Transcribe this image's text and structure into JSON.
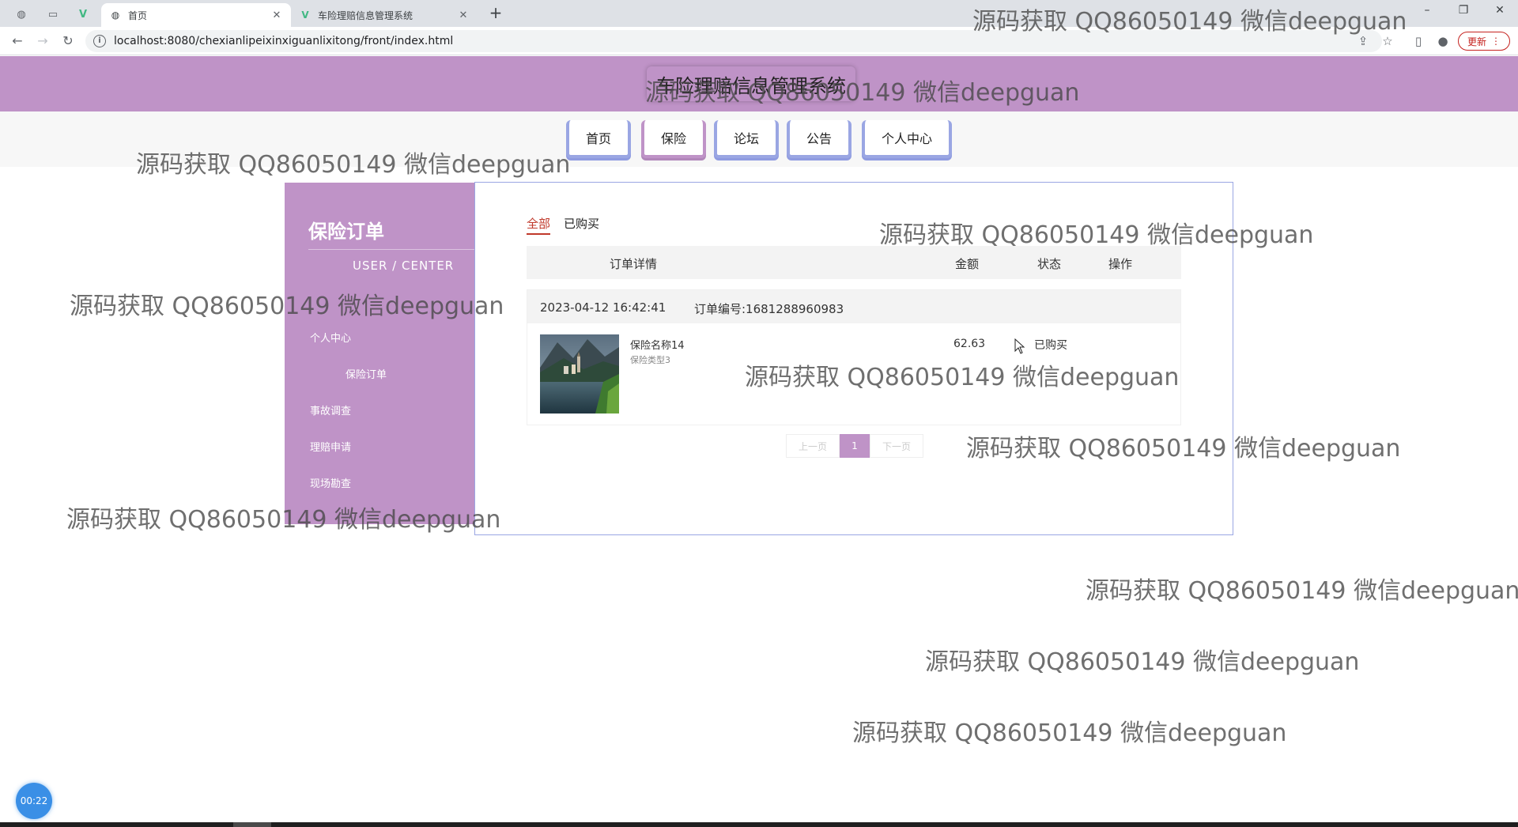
{
  "browser": {
    "tabs": [
      {
        "title": "首页",
        "active": true
      },
      {
        "title": "车险理赔信息管理系统",
        "active": false
      }
    ],
    "url": "localhost:8080/chexianlipeixinxiguanlixitong/front/index.html",
    "update_label": "更新"
  },
  "site": {
    "title": "车险理赔信息管理系统",
    "nav": [
      "首页",
      "保险",
      "论坛",
      "公告",
      "个人中心"
    ],
    "active_nav": "保险"
  },
  "sidebar": {
    "title": "保险订单",
    "subtitle": "USER / CENTER",
    "items": [
      "个人中心",
      "保险订单",
      "事故调查",
      "理赔申请",
      "现场勘查"
    ]
  },
  "orders": {
    "tabs": [
      "全部",
      "已购买"
    ],
    "active_tab": "全部",
    "columns": [
      "订单详情",
      "金额",
      "状态",
      "操作"
    ],
    "list": [
      {
        "time": "2023-04-12 16:42:41",
        "order_no": "订单编号:1681288960983",
        "name": "保险名称14",
        "type": "保险类型3",
        "amount": "62.63",
        "status": "已购买"
      }
    ],
    "pager": {
      "prev": "上一页",
      "current": "1",
      "next": "下一页"
    }
  },
  "watermark": "源码获取 QQ86050149 微信deepguan",
  "timer": "00:22",
  "colors": {
    "header": "#bf93c7",
    "nav_border": "#9aa6e3",
    "active_tab": "#c0392b"
  }
}
